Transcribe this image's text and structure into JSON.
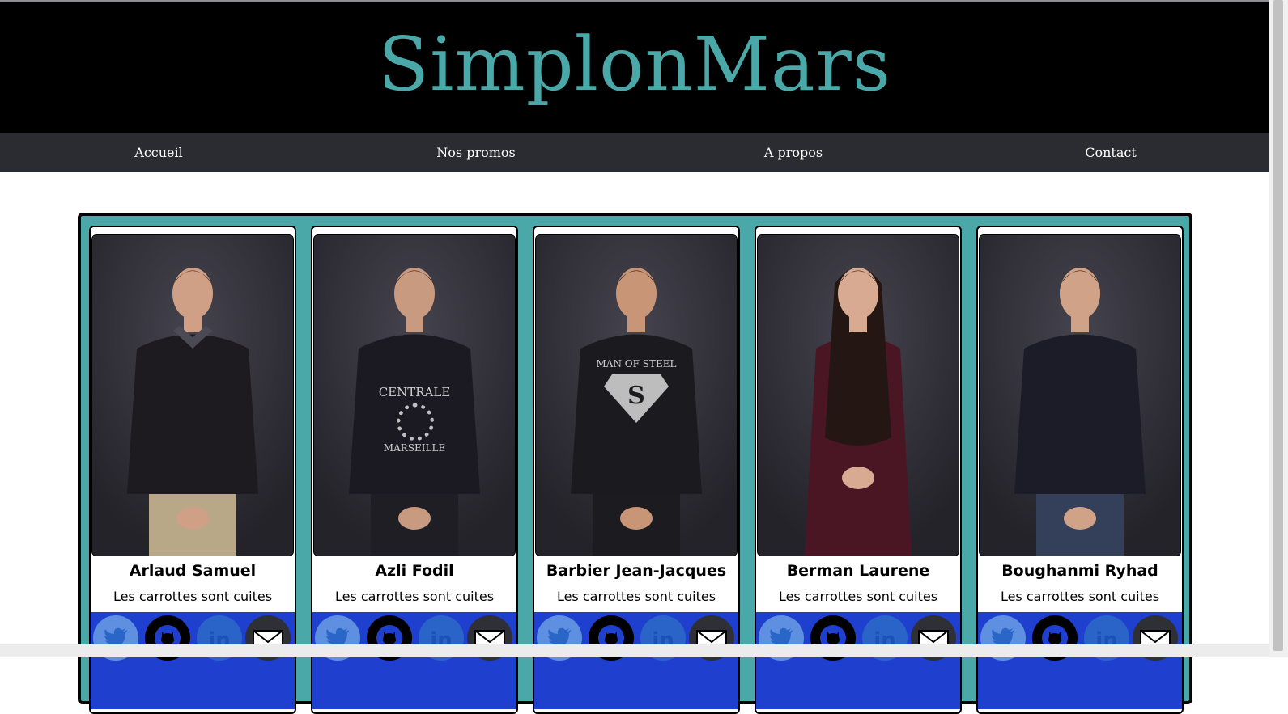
{
  "site": {
    "title": "SimplonMars"
  },
  "nav": [
    {
      "label": "Accueil"
    },
    {
      "label": "Nos promos"
    },
    {
      "label": "A propos"
    },
    {
      "label": "Contact"
    }
  ],
  "students": [
    {
      "name": "Arlaud Samuel",
      "slogan": "Les carrottes sont cuites",
      "shirt": "#1d1a20",
      "pants": "#b9a888",
      "hair": "#3a2a20",
      "skin": "#cf9f86",
      "collar": "#4a4a55"
    },
    {
      "name": "Azli Fodil",
      "slogan": "Les carrottes sont cuites",
      "shirt": "#1b1a22",
      "pants": "#1e1e24",
      "hair": "#1d1612",
      "skin": "#c89a80",
      "print": "CENTRALE",
      "print2": "MARSEILLE"
    },
    {
      "name": "Barbier Jean-Jacques",
      "slogan": "Les carrottes sont cuites",
      "shirt": "#1b1b1f",
      "pants": "#1c1c20",
      "hair": "#141010",
      "skin": "#c99577",
      "print": "MAN OF STEEL"
    },
    {
      "name": "Berman Laurene",
      "slogan": "Les carrottes sont cuites",
      "shirt": "#4a1624",
      "pants": "#4a1624",
      "hair": "#241612",
      "skin": "#d8aa92"
    },
    {
      "name": "Boughanmi Ryhad",
      "slogan": "Les carrottes sont cuites",
      "shirt": "#1c1b28",
      "pants": "#34405a",
      "hair": "#1a1412",
      "skin": "#d0a388"
    }
  ],
  "icons": [
    "twitter-icon",
    "github-icon",
    "linkedin-icon",
    "mail-icon"
  ],
  "colors": {
    "accent": "#4aa8a8",
    "header": "#000000",
    "nav": "#2b2c31",
    "social_bar": "#1f3fcf"
  }
}
